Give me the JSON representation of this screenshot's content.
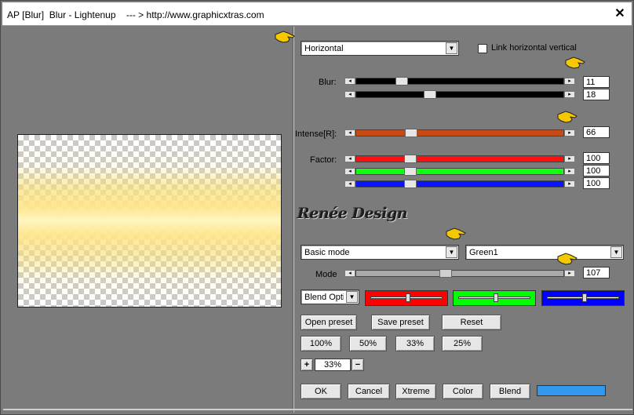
{
  "window": {
    "title": "AP [Blur]  Blur - Lightenup    --- > http://www.graphicxtras.com",
    "close_glyph": "✕"
  },
  "direction_select": {
    "value": "Horizontal"
  },
  "link_checkbox": {
    "label": "Link horizontal vertical",
    "checked": false
  },
  "blur": {
    "label": "Blur:",
    "values": [
      "11",
      "18"
    ]
  },
  "intense": {
    "label": "Intense[R]:",
    "value": "66",
    "color": "#c54a14"
  },
  "factor": {
    "label": "Factor:",
    "values": [
      "100",
      "100",
      "100"
    ],
    "colors": [
      "#ff1010",
      "#10ff10",
      "#0a14ff"
    ]
  },
  "logo_text": "Renée Design",
  "mode_select": {
    "value": "Basic mode"
  },
  "preset_select": {
    "value": "Green1"
  },
  "mode": {
    "label": "Mode",
    "value": "107"
  },
  "blend_select": {
    "value": "Blend Opti"
  },
  "blend_colors": [
    "#ff0000",
    "#00ff00",
    "#0000ff"
  ],
  "buttons": {
    "open_preset": "Open preset",
    "save_preset": "Save preset",
    "reset": "Reset",
    "zoom_100": "100%",
    "zoom_50": "50%",
    "zoom_33": "33%",
    "zoom_25": "25%",
    "zoom_plus": "+",
    "zoom_minus": "−",
    "ok": "OK",
    "cancel": "Cancel",
    "xtreme": "Xtreme",
    "color": "Color",
    "blend": "Blend"
  },
  "zoom_value": "33%",
  "swatch_color": "#3399ee",
  "hand_icon_color": "#f5c800"
}
